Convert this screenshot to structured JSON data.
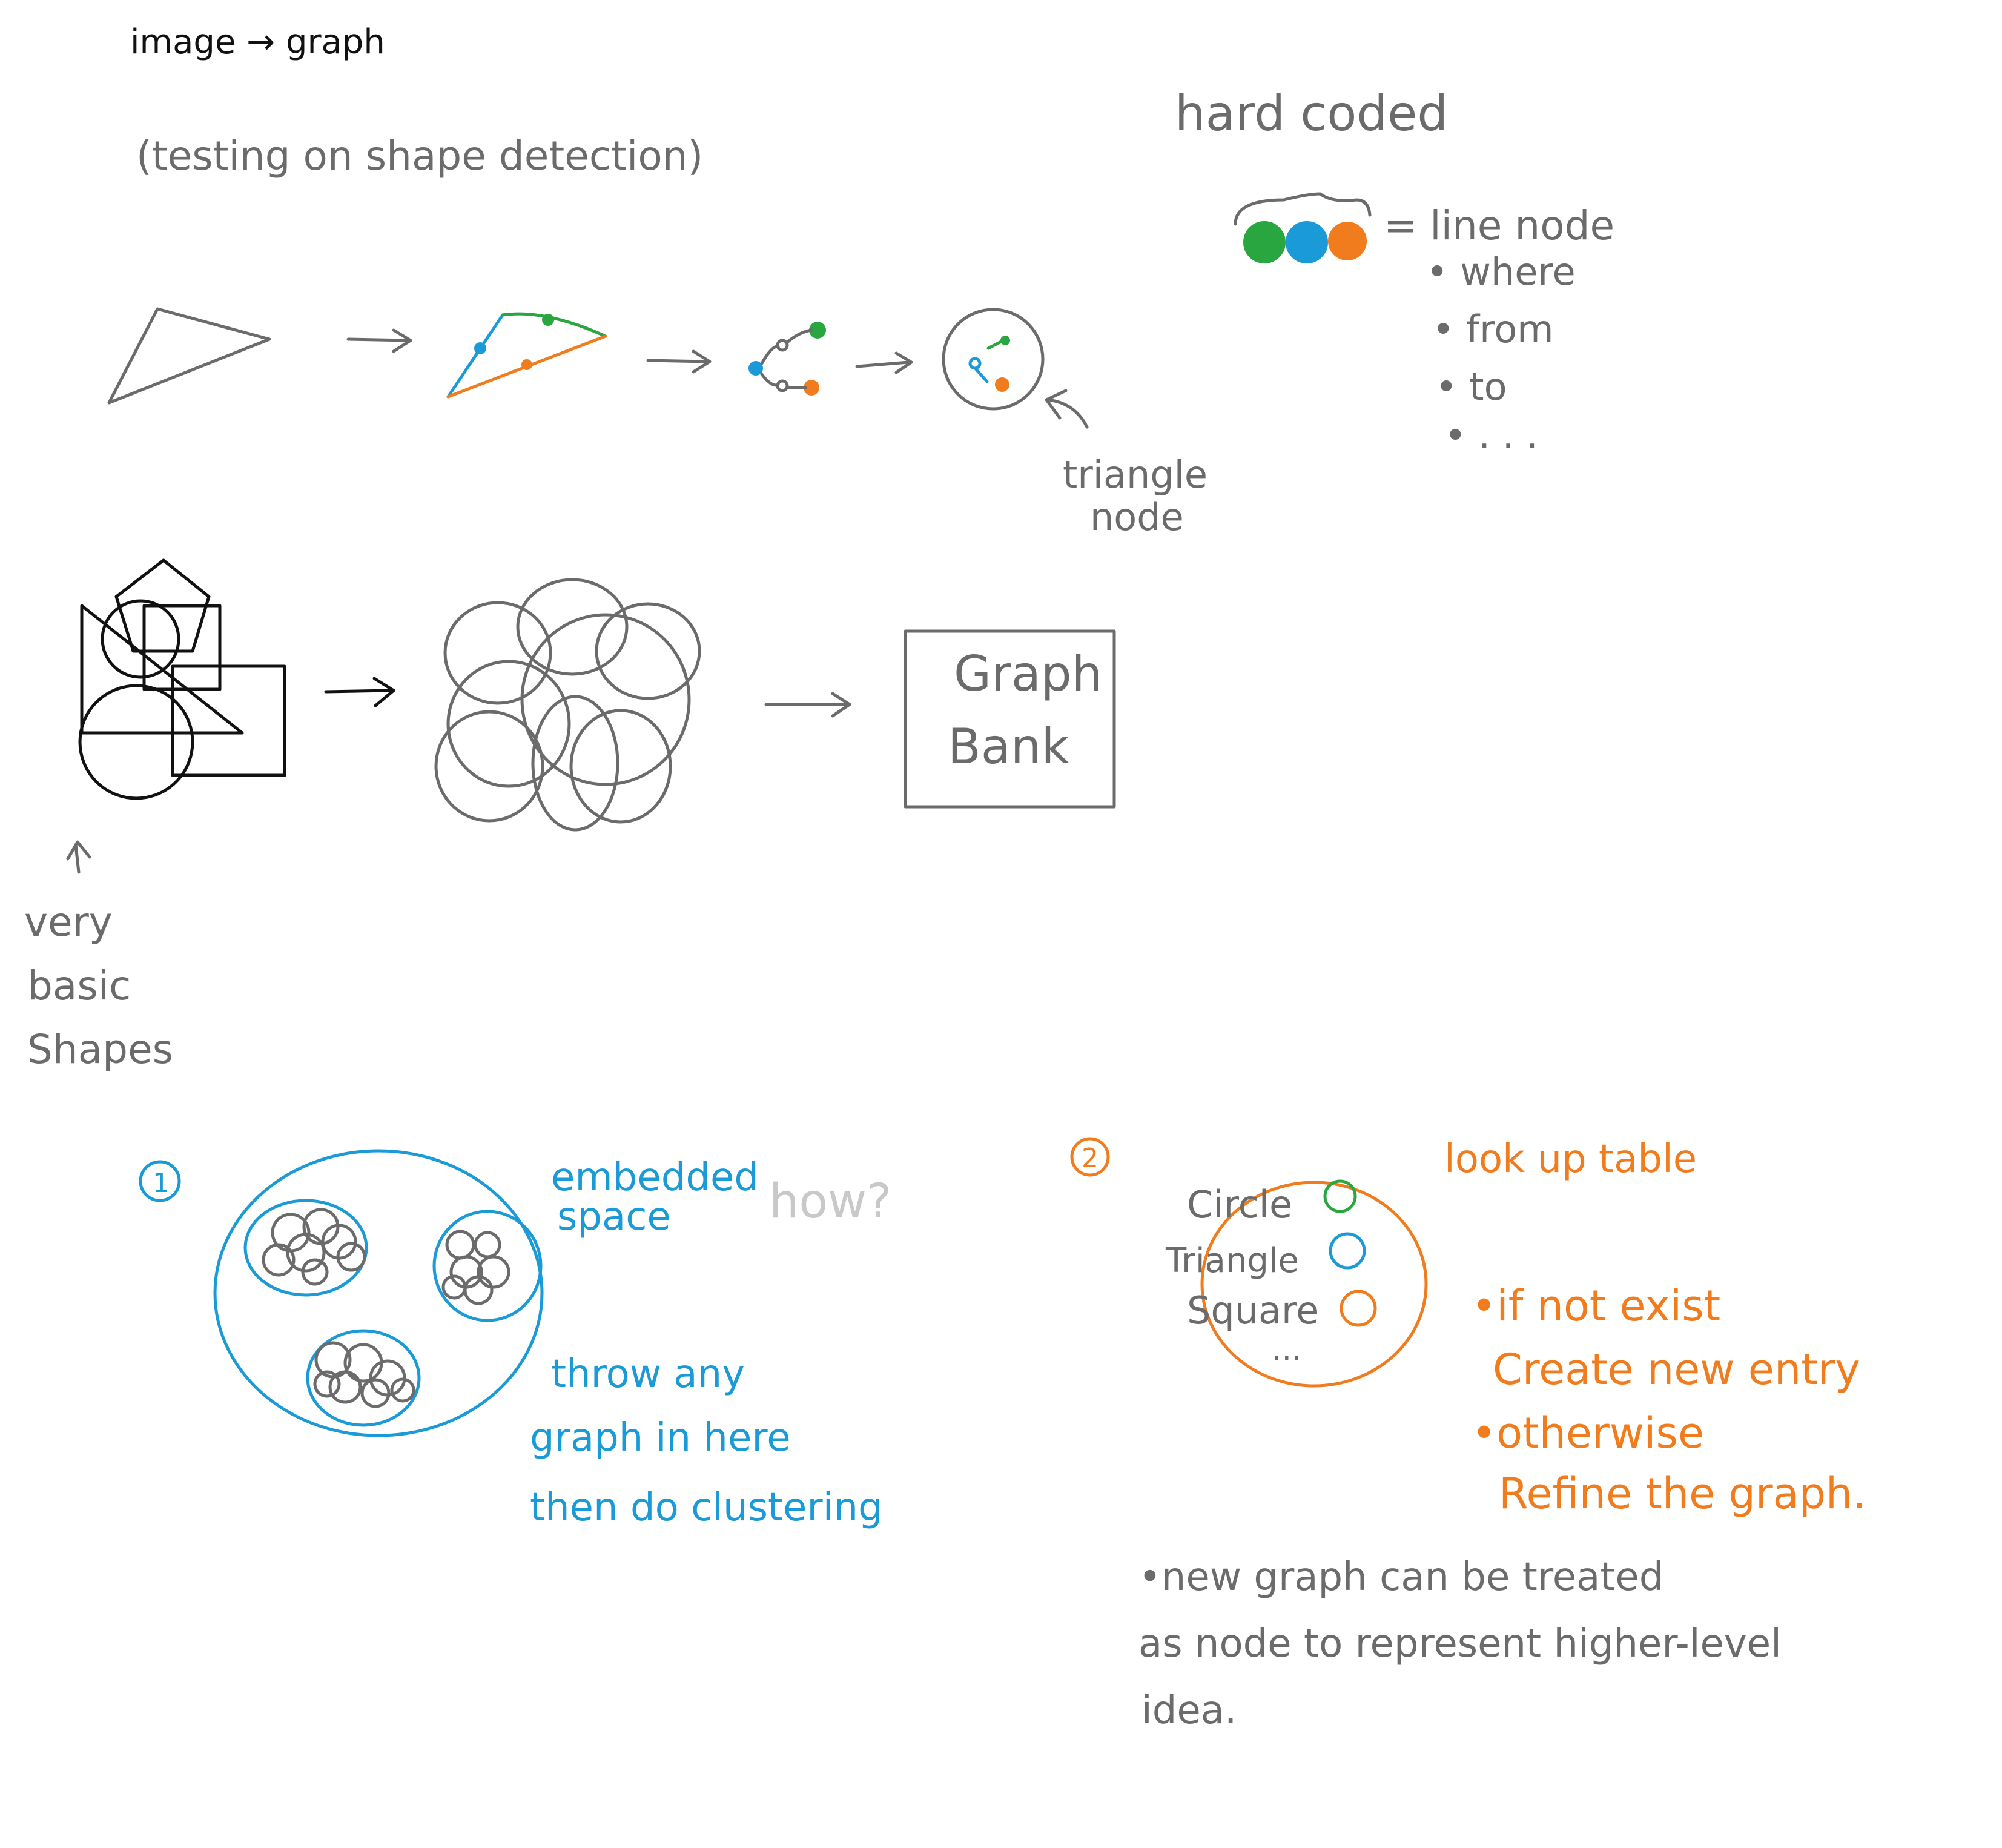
{
  "title": "image → graph",
  "subtitle": "(testing on shape detection)",
  "hard_coded": {
    "heading": "hard coded",
    "equals_label": "= line node",
    "items": [
      "• where",
      "• from",
      "• to",
      "• . . ."
    ]
  },
  "triangle_node_label": [
    "triangle",
    "node"
  ],
  "graph_bank_label": [
    "Graph",
    "Bank"
  ],
  "basic_shapes_label": [
    "very",
    "basic",
    "Shapes"
  ],
  "option1": {
    "number": "1",
    "space_label": [
      "embedded",
      "space"
    ],
    "question": "how?",
    "description": [
      "throw any",
      "graph in here",
      "then do clustering"
    ]
  },
  "option2": {
    "number": "2",
    "table_label": "look up table",
    "entries": [
      "Circle",
      "Triangle",
      "Square",
      "..."
    ],
    "rules": [
      "•if not exist",
      "Create new entry",
      "•otherwise",
      "Refine the graph."
    ]
  },
  "note": [
    "•new graph can be treated",
    "as node to represent higher-level",
    "idea."
  ],
  "colors": {
    "gray": "#6b6b6b",
    "black": "#111111",
    "blue": "#1a9ad6",
    "orange": "#f07c1e",
    "green": "#2aa640",
    "light_gray": "#c8c8c8"
  }
}
